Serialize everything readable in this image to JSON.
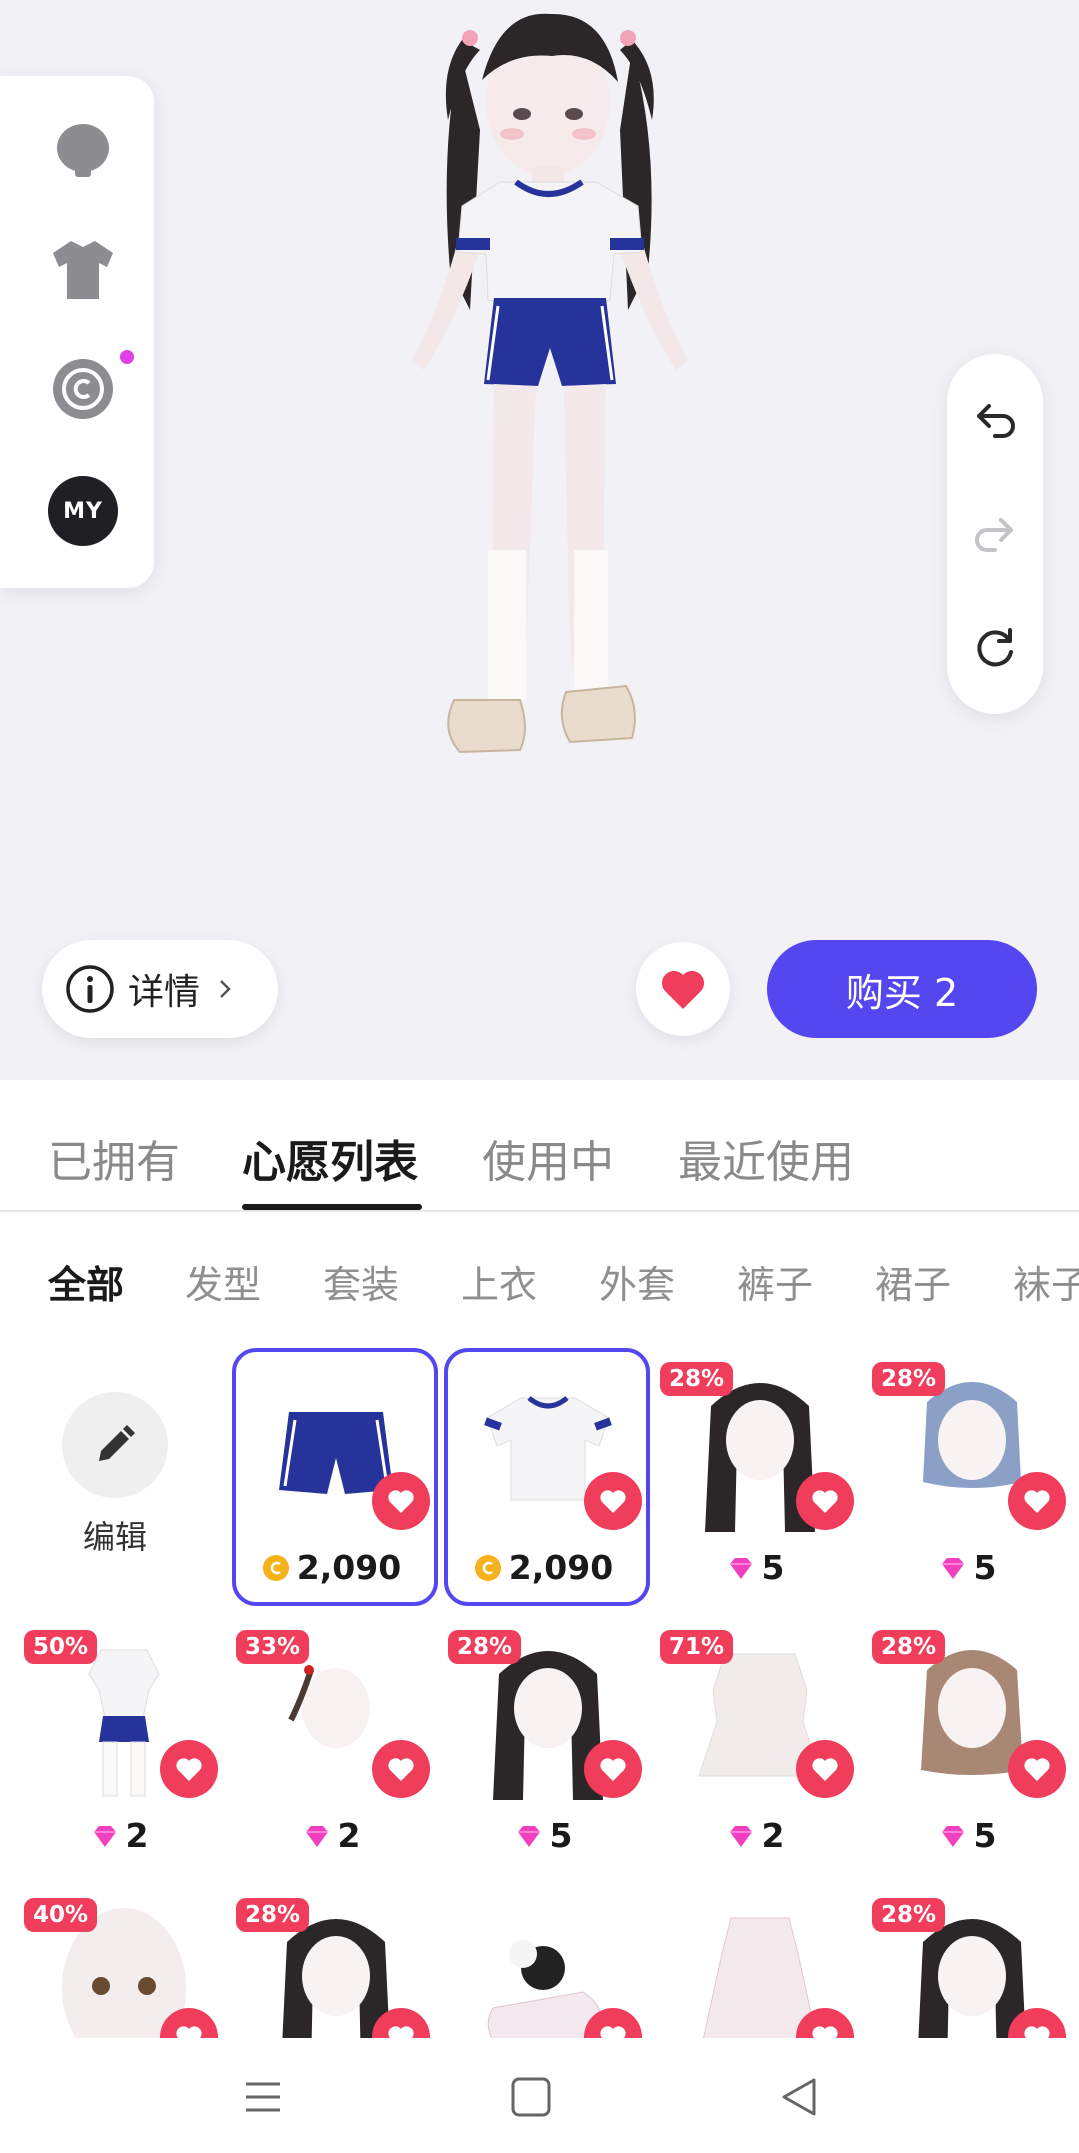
{
  "stage": {
    "details_label": "详情",
    "buy_label": "购买 2",
    "my_badge": "MY",
    "left_tools": [
      "head-icon",
      "shirt-icon",
      "coin-circle-icon",
      "my-badge"
    ],
    "right_tools": [
      "undo-icon",
      "redo-icon",
      "reset-icon"
    ]
  },
  "tabs": [
    {
      "label": "已拥有",
      "active": false
    },
    {
      "label": "心愿列表",
      "active": true
    },
    {
      "label": "使用中",
      "active": false
    },
    {
      "label": "最近使用",
      "active": false
    }
  ],
  "categories": [
    {
      "label": "全部",
      "active": true
    },
    {
      "label": "发型",
      "active": false
    },
    {
      "label": "套装",
      "active": false
    },
    {
      "label": "上衣",
      "active": false
    },
    {
      "label": "外套",
      "active": false
    },
    {
      "label": "裤子",
      "active": false
    },
    {
      "label": "裙子",
      "active": false
    },
    {
      "label": "袜子",
      "active": false
    }
  ],
  "edit_label": "编辑",
  "items": [
    {
      "kind": "shorts",
      "badge": "",
      "currency": "coin",
      "price": "2,090",
      "selected": true
    },
    {
      "kind": "tshirt",
      "badge": "",
      "currency": "coin",
      "price": "2,090",
      "selected": true
    },
    {
      "kind": "hair-pigtails-dark",
      "badge": "28%",
      "currency": "gem",
      "price": "5",
      "selected": false
    },
    {
      "kind": "hair-bob-blue",
      "badge": "28%",
      "currency": "gem",
      "price": "5",
      "selected": false
    },
    {
      "kind": "outfit-gym",
      "badge": "50%",
      "currency": "gem",
      "price": "2",
      "selected": false
    },
    {
      "kind": "hair-side-tail",
      "badge": "33%",
      "currency": "gem",
      "price": "2",
      "selected": false
    },
    {
      "kind": "hair-shag-dark",
      "badge": "28%",
      "currency": "gem",
      "price": "5",
      "selected": false
    },
    {
      "kind": "outfit-white-dress",
      "badge": "71%",
      "currency": "gem",
      "price": "2",
      "selected": false
    },
    {
      "kind": "hair-brown-short",
      "badge": "28%",
      "currency": "gem",
      "price": "5",
      "selected": false
    },
    {
      "kind": "face-doll",
      "badge": "40%",
      "currency": "gem",
      "price": "",
      "selected": false
    },
    {
      "kind": "hair-long-dark",
      "badge": "28%",
      "currency": "gem",
      "price": "",
      "selected": false
    },
    {
      "kind": "shoes-panda",
      "badge": "",
      "currency": "gem",
      "price": "",
      "selected": false
    },
    {
      "kind": "outfit-pink-dress",
      "badge": "",
      "currency": "gem",
      "price": "",
      "selected": false
    },
    {
      "kind": "hair-buns-dark",
      "badge": "28%",
      "currency": "gem",
      "price": "",
      "selected": false
    }
  ],
  "colors": {
    "accent": "#5547f0",
    "heart": "#ef3d5b",
    "badge": "#ef3d5b",
    "coin": "#f5b21b",
    "gem": "#f03fbf"
  },
  "navbar": [
    "menu-icon",
    "home-square-icon",
    "back-triangle-icon"
  ]
}
